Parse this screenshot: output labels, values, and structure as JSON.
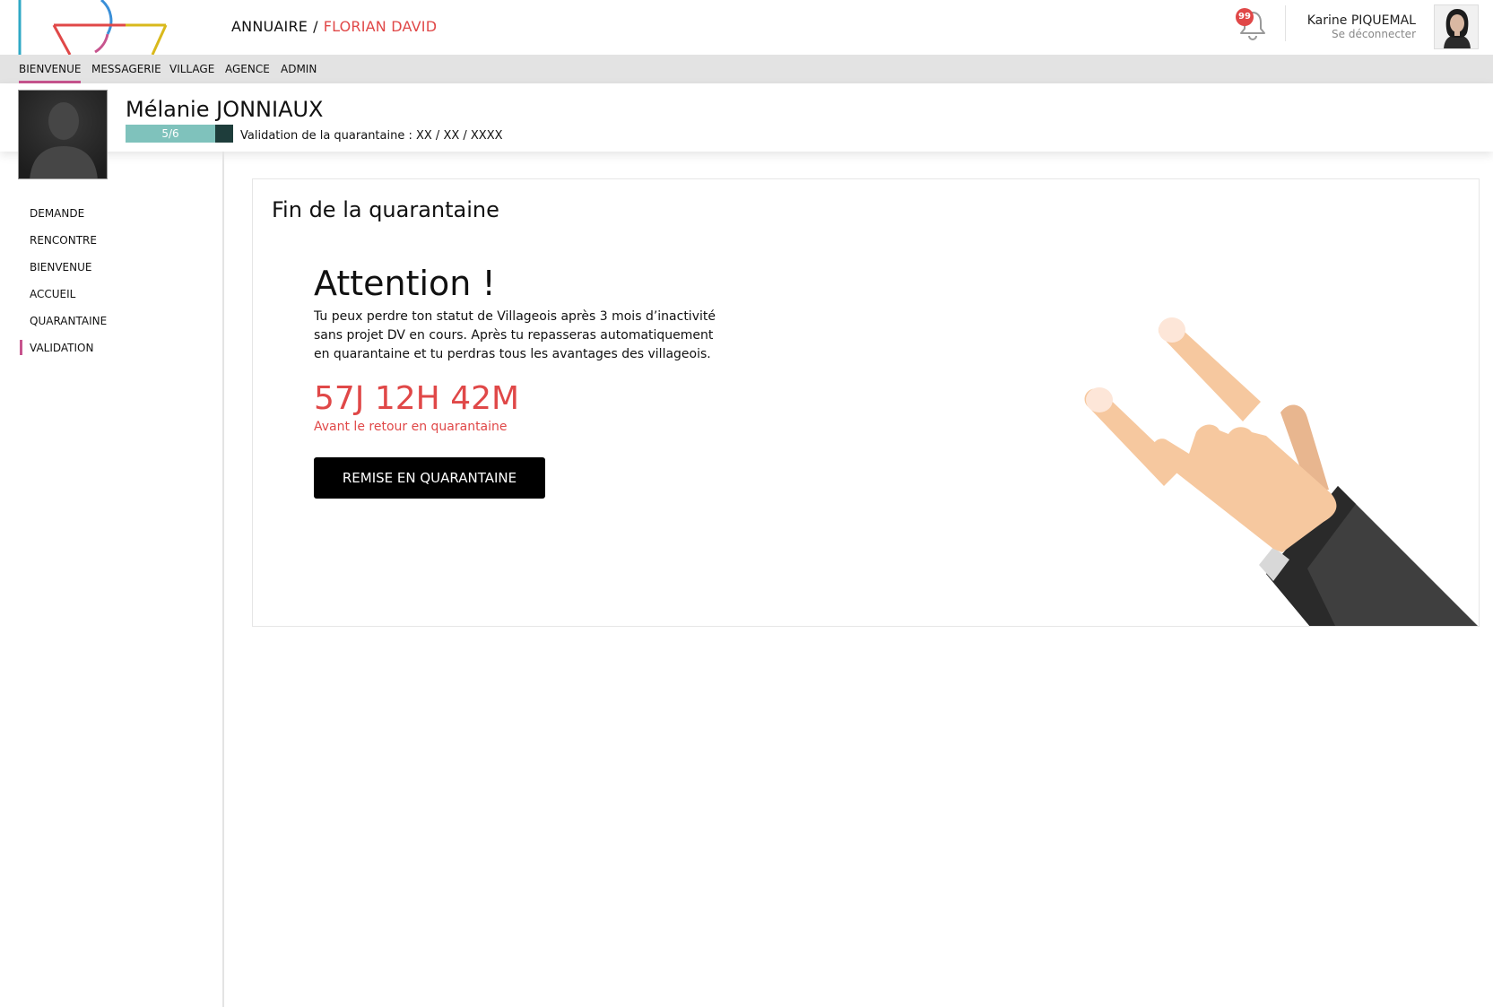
{
  "header": {
    "breadcrumb_root": "ANNUAIRE",
    "breadcrumb_sep": "/",
    "breadcrumb_current": "FLORIAN DAVID",
    "notification_count": "99",
    "user_name": "Karine PIQUEMAL",
    "logout_label": "Se déconnecter"
  },
  "nav": {
    "items": [
      {
        "label": "BIENVENUE",
        "active": true
      },
      {
        "label": "MESSAGERIE"
      },
      {
        "label": "VILLAGE"
      },
      {
        "label": "AGENCE"
      },
      {
        "label": "ADMIN"
      }
    ]
  },
  "profile": {
    "name": "Mélanie JONNIAUX",
    "progress_label": "5/6",
    "progress_value": 0.8333,
    "validation_text": "Validation de la quarantaine : XX / XX / XXXX"
  },
  "sidebar": {
    "items": [
      {
        "label": "DEMANDE"
      },
      {
        "label": "RENCONTRE"
      },
      {
        "label": "BIENVENUE"
      },
      {
        "label": "ACCUEIL"
      },
      {
        "label": "QUARANTAINE"
      },
      {
        "label": "VALIDATION",
        "active": true
      }
    ]
  },
  "card": {
    "title": "Fin de la quarantaine",
    "heading": "Attention !",
    "message": "Tu peux perdre ton statut de Villageois après 3 mois d’inactivité sans projet DV en cours. Après tu repasseras automatiquement en quarantaine et tu perdras tous les avantages des villageois.",
    "countdown": "57J 12H 42M",
    "countdown_caption": "Avant le retour en quarantaine",
    "button_label": "REMISE EN QUARANTAINE"
  },
  "colors": {
    "accent_red": "#e04848",
    "nav_active": "#c7548e",
    "progress_fill": "#7fc2bc",
    "progress_track": "#1e3d3b",
    "nav_background": "#e3e3e3"
  },
  "icons": {
    "notification": "bell-icon",
    "illustration": "rock-hand-illustration"
  }
}
